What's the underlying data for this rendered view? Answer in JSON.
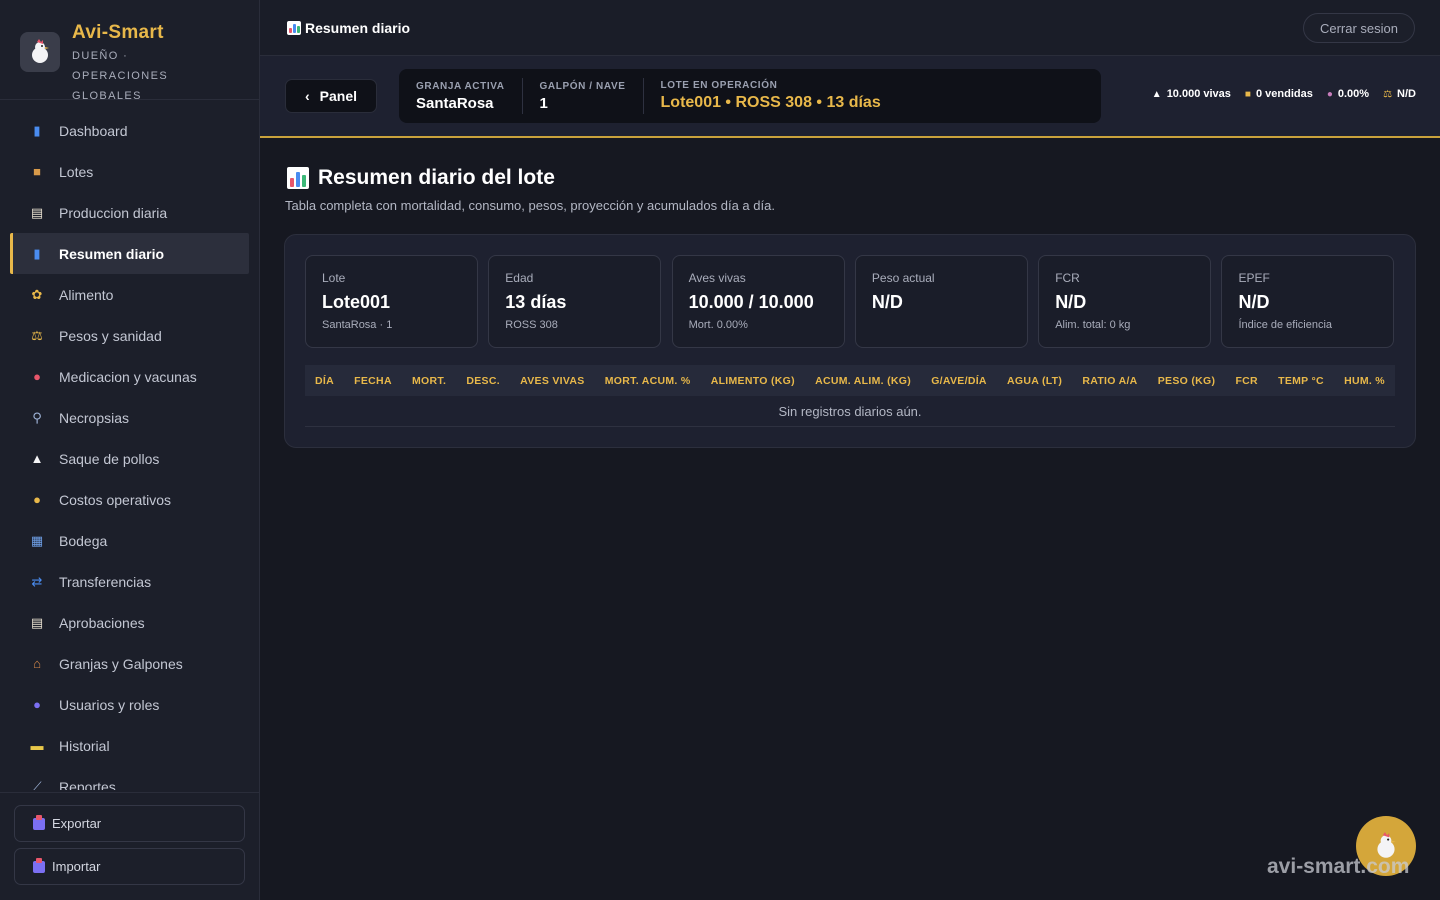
{
  "brand": {
    "name": "Avi-Smart",
    "subtitle": "DUEÑO · OPERACIONES GLOBALES"
  },
  "sidebar": {
    "items": [
      {
        "label": "Dashboard",
        "icon": "bar-chart-icon",
        "active": false
      },
      {
        "label": "Lotes",
        "icon": "box-icon",
        "active": false
      },
      {
        "label": "Produccion diaria",
        "icon": "clipboard-icon",
        "active": false
      },
      {
        "label": "Resumen diario",
        "icon": "bar-chart-icon",
        "active": true
      },
      {
        "label": "Alimento",
        "icon": "corn-icon",
        "active": false
      },
      {
        "label": "Pesos y sanidad",
        "icon": "scale-icon",
        "active": false
      },
      {
        "label": "Medicacion y vacunas",
        "icon": "pill-icon",
        "active": false
      },
      {
        "label": "Necropsias",
        "icon": "microscope-icon",
        "active": false
      },
      {
        "label": "Saque de pollos",
        "icon": "chicken-icon",
        "active": false
      },
      {
        "label": "Costos operativos",
        "icon": "money-bag-icon",
        "active": false
      },
      {
        "label": "Bodega",
        "icon": "store-icon",
        "active": false
      },
      {
        "label": "Transferencias",
        "icon": "transfer-icon",
        "active": false
      },
      {
        "label": "Aprobaciones",
        "icon": "clipboard-icon",
        "active": false
      },
      {
        "label": "Granjas y Galpones",
        "icon": "farm-icon",
        "active": false
      },
      {
        "label": "Usuarios y roles",
        "icon": "users-icon",
        "active": false
      },
      {
        "label": "Historial",
        "icon": "folder-icon",
        "active": false
      },
      {
        "label": "Reportes",
        "icon": "line-chart-icon",
        "active": false
      }
    ],
    "export_label": "Exportar",
    "import_label": "Importar"
  },
  "topbar": {
    "title": "Resumen diario",
    "logout_label": "Cerrar sesion"
  },
  "context": {
    "panel_label": "Panel",
    "farm_label": "GRANJA ACTIVA",
    "farm_value": "SantaRosa",
    "shed_label": "GALPÓN / NAVE",
    "shed_value": "1",
    "lot_label": "LOTE EN OPERACIÓN",
    "lot_value": "Lote001 • ROSS 308 • 13 días",
    "stats": {
      "alive": "10.000 vivas",
      "sold": "0 vendidas",
      "mortality": "0.00%",
      "weight": "N/D"
    }
  },
  "main": {
    "title": "Resumen diario del lote",
    "subtitle": "Tabla completa con mortalidad, consumo, pesos, proyección y acumulados día a día.",
    "kpis": [
      {
        "label": "Lote",
        "value": "Lote001",
        "sub": "SantaRosa · 1"
      },
      {
        "label": "Edad",
        "value": "13 días",
        "sub": "ROSS 308"
      },
      {
        "label": "Aves vivas",
        "value": "10.000 / 10.000",
        "sub": "Mort. 0.00%"
      },
      {
        "label": "Peso actual",
        "value": "N/D",
        "sub": ""
      },
      {
        "label": "FCR",
        "value": "N/D",
        "sub": "Alim. total: 0 kg"
      },
      {
        "label": "EPEF",
        "value": "N/D",
        "sub": "Índice de eficiencia"
      }
    ],
    "table": {
      "columns": [
        "DÍA",
        "FECHA",
        "MORT.",
        "DESC.",
        "AVES VIVAS",
        "MORT. ACUM. %",
        "ALIMENTO (KG)",
        "ACUM. ALIM. (KG)",
        "G/AVE/DÍA",
        "AGUA (LT)",
        "RATIO A/A",
        "PESO (KG)",
        "FCR",
        "TEMP °C",
        "HUM. %"
      ],
      "empty_message": "Sin registros diarios aún."
    }
  },
  "watermark": "avi-smart.com",
  "colors": {
    "accent": "#e8b84a",
    "background": "#161821",
    "sidebar": "#1c1f2a",
    "card": "#1e2130"
  }
}
